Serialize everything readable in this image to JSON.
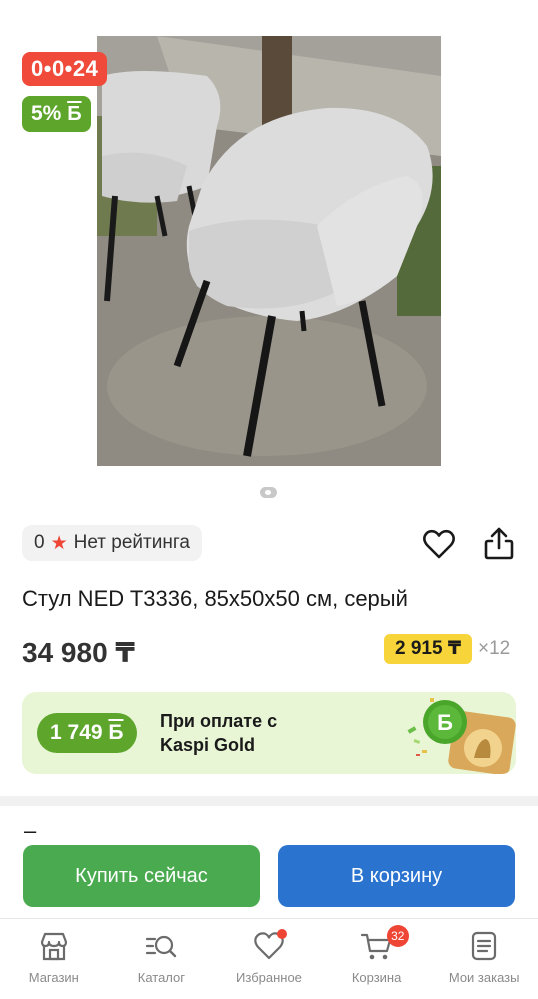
{
  "gallery": {
    "promo_timer": "0•0•24",
    "bonus_percent": "5%",
    "bonus_glyph": "Б",
    "image_alt": "chair-photo"
  },
  "rating": {
    "value": "0",
    "label": "Нет рейтинга"
  },
  "product": {
    "title": "Стул NED T3336, 85x50x50 см, серый",
    "price": "34 980 ₸",
    "installment_amount": "2 915 ₸",
    "installment_term": "×12"
  },
  "kaspi_gold": {
    "bonus": "1 749",
    "bonus_glyph": "Б",
    "line1": "При оплате с",
    "line2": "Kaspi Gold",
    "logo_glyph": "Б"
  },
  "section": {
    "dash": "–"
  },
  "actions": {
    "buy_now": "Купить сейчас",
    "add_to_cart": "В корзину"
  },
  "tabbar": {
    "items": [
      {
        "label": "Магазин",
        "icon": "shop-icon"
      },
      {
        "label": "Каталог",
        "icon": "catalog-search-icon"
      },
      {
        "label": "Избранное",
        "icon": "heart-icon"
      },
      {
        "label": "Корзина",
        "icon": "cart-icon",
        "badge": "32"
      },
      {
        "label": "Мои заказы",
        "icon": "orders-icon"
      }
    ]
  },
  "colors": {
    "promo_red": "#ef4a3a",
    "bonus_green": "#5da52b",
    "installment_yellow": "#f7d53a",
    "buy_green": "#4aaa4f",
    "cart_blue": "#2a74d0"
  }
}
